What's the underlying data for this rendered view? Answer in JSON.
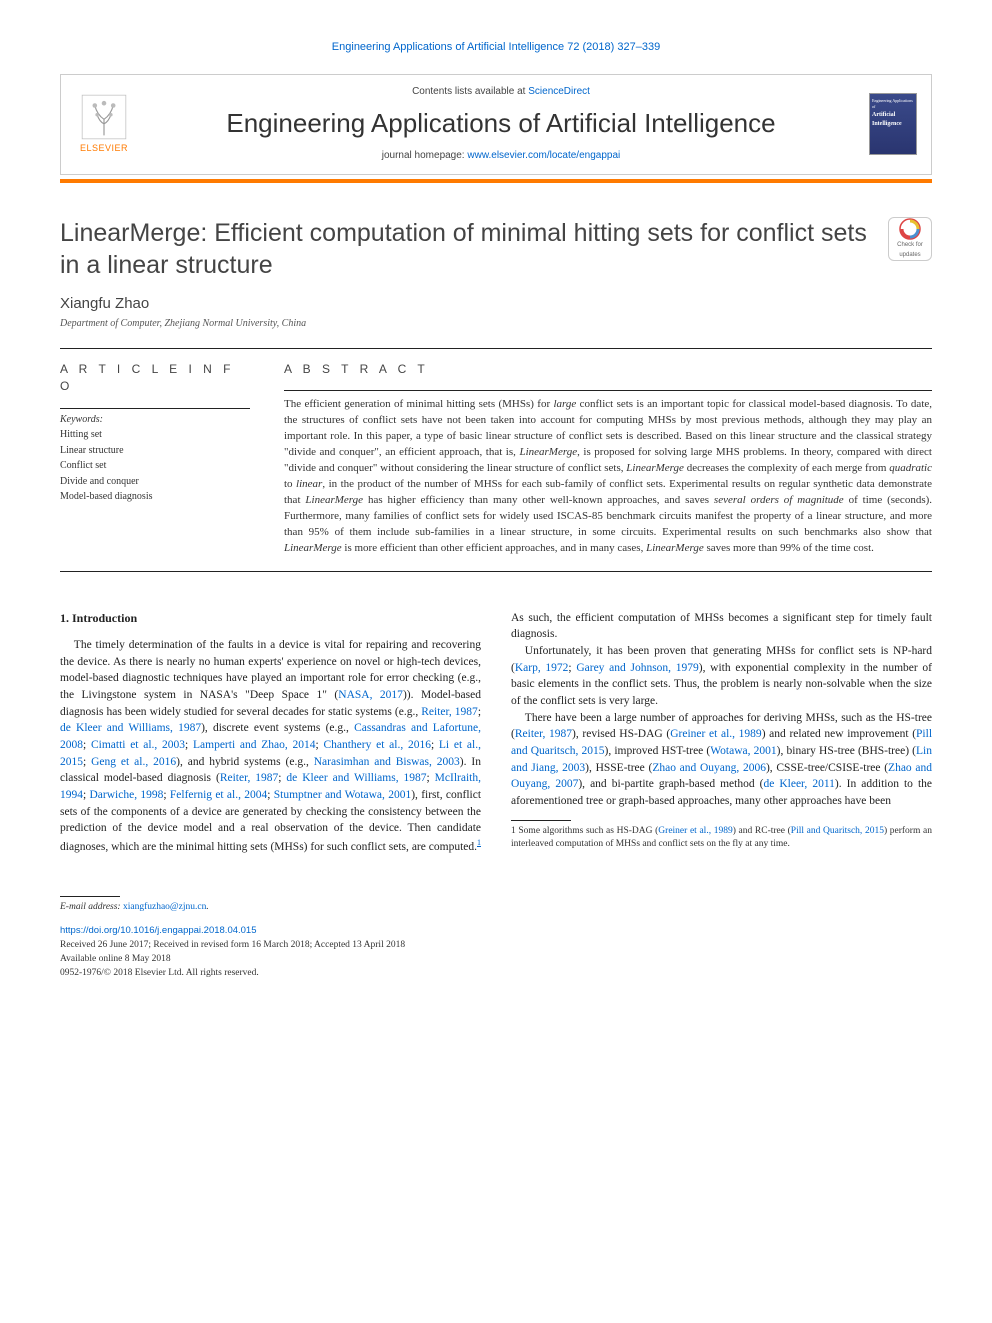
{
  "runningHeader": "Engineering Applications of Artificial Intelligence 72 (2018) 327–339",
  "banner": {
    "publisher": "ELSEVIER",
    "contentsLine": "Contents lists available at ",
    "contentsLink": "ScienceDirect",
    "journalName": "Engineering Applications of Artificial Intelligence",
    "homepageLabel": "journal homepage: ",
    "homepageUrl": "www.elsevier.com/locate/engappai",
    "coverLines": {
      "l1": "Engineering Applications of",
      "l2": "Artificial Intelligence"
    }
  },
  "checkBadge": {
    "l1": "Check for",
    "l2": "updates"
  },
  "title": "LinearMerge: Efficient computation of minimal hitting sets for conflict sets in a linear structure",
  "author": "Xiangfu Zhao",
  "affiliation": "Department of Computer, Zhejiang Normal University, China",
  "articleInfoLabel": "A R T I C L E   I N F O",
  "abstractLabel": "A B S T R A C T",
  "keywordsHead": "Keywords:",
  "keywords": [
    "Hitting set",
    "Linear structure",
    "Conflict set",
    "Divide and conquer",
    "Model-based diagnosis"
  ],
  "abstract": {
    "p1a": "The efficient generation of minimal hitting sets (MHSs) for ",
    "p1b": "large",
    "p1c": " conflict sets is an important topic for classical model-based diagnosis. To date, the structures of conflict sets have not been taken into account for computing MHSs by most previous methods, although they may play an important role. In this paper, a type of basic linear structure of conflict sets is described. Based on this linear structure and the classical strategy \"divide and conquer\", an efficient approach, that is, ",
    "p1d": "LinearMerge",
    "p1e": ", is proposed for solving large MHS problems. In theory, compared with direct \"divide and conquer\" without considering the linear structure of conflict sets, ",
    "p1f": "LinearMerge",
    "p1g": " decreases the complexity of each merge from ",
    "p1h": "quadratic",
    "p1i": " to ",
    "p1j": "linear",
    "p1k": ", in the product of the number of MHSs for each sub-family of conflict sets. Experimental results on regular synthetic data demonstrate that ",
    "p1l": "LinearMerge",
    "p1m": " has higher efficiency than many other well-known approaches, and saves ",
    "p1n": "several orders of magnitude",
    "p1o": " of time (seconds). Furthermore, many families of conflict sets for widely used ISCAS-85 benchmark circuits manifest the property of a linear structure, and more than 95% of them include sub-families in a linear structure, in some circuits. Experimental results on such benchmarks also show that ",
    "p1p": "LinearMerge",
    "p1q": " is more efficient than other efficient approaches, and in many cases, ",
    "p1r": "LinearMerge",
    "p1s": " saves more than 99% of the time cost."
  },
  "sectionHead": "1. Introduction",
  "body": {
    "c1p1a": "The timely determination of the faults in a device is vital for repairing and recovering the device. As there is nearly no human experts' experience on novel or high-tech devices, model-based diagnostic techniques have played an important role for error checking (e.g., the Livingstone system in NASA's \"Deep Space 1\" (",
    "c1r1": "NASA, 2017",
    "c1p1b": ")). Model-based diagnosis has been widely studied for several decades for static systems (e.g., ",
    "c1r2": "Reiter, 1987",
    "c1s1": "; ",
    "c1r3": "de Kleer and Williams, 1987",
    "c1p1c": "), discrete event systems (e.g., ",
    "c1r4": "Cassandras and Lafortune, 2008",
    "c1s2": "; ",
    "c1r5": "Cimatti et al., 2003",
    "c1s3": "; ",
    "c1r6": "Lamperti and Zhao, 2014",
    "c1s4": "; ",
    "c1r7": "Chanthery et al., 2016",
    "c1s5": "; ",
    "c1r8": "Li et al., 2015",
    "c1s6": "; ",
    "c1r9": "Geng et al., 2016",
    "c1p1d": "), and hybrid systems (e.g., ",
    "c1r10": "Narasimhan and Biswas, 2003",
    "c1p1e": "). In classical model-based diagnosis (",
    "c1r11": "Reiter, 1987",
    "c1s7": "; ",
    "c1r12": "de Kleer and Williams, 1987",
    "c1s8": "; ",
    "c1r13": "McIlraith, 1994",
    "c1s9": "; ",
    "c1r14": "Darwiche, 1998",
    "c1s10": "; ",
    "c1r15": "Felfernig et al., 2004",
    "c1s11": "; ",
    "c1r16": "Stumptner and Wotawa, 2001",
    "c1p1f": "), first, conflict sets of the components of a device are generated by checking the consistency between the prediction of the device model and a real observation of the device. Then candidate diagnoses, which are the minimal hitting sets (MHSs) ",
    "c2p1a": "for such conflict sets, are computed.",
    "fnmark": "1",
    "c2p1b": " As such, the efficient computation of MHSs becomes a significant step for timely fault diagnosis.",
    "c2p2a": "Unfortunately, it has been proven that generating MHSs for conflict sets is NP-hard (",
    "c2r1": "Karp, 1972",
    "c2s1": "; ",
    "c2r2": "Garey and Johnson, 1979",
    "c2p2b": "), with exponential complexity in the number of basic elements in the conflict sets. Thus, the problem is nearly non-solvable when the size of the conflict sets is very large.",
    "c2p3a": "There have been a large number of approaches for deriving MHSs, such as the HS-tree (",
    "c2r3": "Reiter, 1987",
    "c2p3b": "), revised HS-DAG (",
    "c2r4": "Greiner et al., 1989",
    "c2p3c": ") and related new improvement (",
    "c2r5": "Pill and Quaritsch, 2015",
    "c2p3d": "), improved HST-tree (",
    "c2r6": "Wotawa, 2001",
    "c2p3e": "), binary HS-tree (BHS-tree) (",
    "c2r7": "Lin and Jiang, 2003",
    "c2p3f": "), HSSE-tree (",
    "c2r8": "Zhao and Ouyang, 2006",
    "c2p3g": "), CSSE-tree/CSISE-tree (",
    "c2r9": "Zhao and Ouyang, 2007",
    "c2p3h": "), and bi-partite graph-based method (",
    "c2r10": "de Kleer, 2011",
    "c2p3i": "). In addition to the aforementioned tree or graph-based approaches, many other approaches have been"
  },
  "footnote": {
    "mark": "1",
    "a": " Some algorithms such as HS-DAG (",
    "r1": "Greiner et al., 1989",
    "b": ") and RC-tree (",
    "r2": "Pill and Quaritsch, 2015",
    "c": ") perform an interleaved computation of MHSs and conflict sets on the fly at any time."
  },
  "emailLabel": "E-mail address: ",
  "email": "xiangfuzhao@zjnu.cn",
  "emailSuffix": ".",
  "doi": "https://doi.org/10.1016/j.engappai.2018.04.015",
  "history": "Received 26 June 2017; Received in revised form 16 March 2018; Accepted 13 April 2018",
  "online": "Available online 8 May 2018",
  "copyright": "0952-1976/© 2018 Elsevier Ltd. All rights reserved."
}
